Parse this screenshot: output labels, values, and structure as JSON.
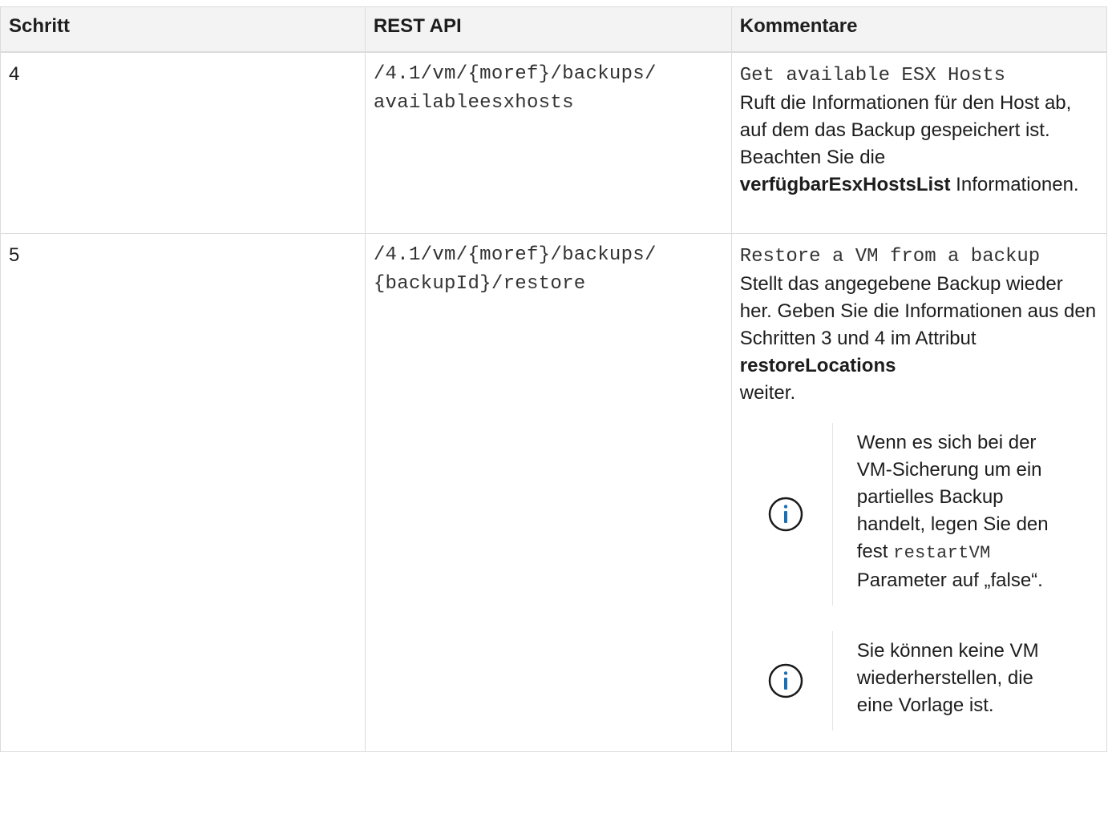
{
  "table": {
    "headers": {
      "step": "Schritt",
      "api": "REST API",
      "comment": "Kommentare"
    },
    "rows": [
      {
        "step": "4",
        "api_line1": "/4.1/vm/{moref}/backups/",
        "api_line2": "availableesxhosts",
        "comment_code": "Get available ESX Hosts",
        "comment_text": "Ruft die Informationen für den Host ab, auf dem das Backup gespeichert ist. Beachten Sie die",
        "comment_bold": "verfügbarEsxHostsList",
        "comment_after": "Informationen."
      },
      {
        "step": "5",
        "api_line1": "/4.1/vm/{moref}/backups/",
        "api_line2": "{backupId}/restore",
        "comment_code": "Restore a VM from a backup",
        "comment_text": "Stellt das angegebene Backup wieder her. Geben Sie die Informationen aus den Schritten 3 und 4 im Attribut",
        "comment_bold": "restoreLocations",
        "comment_after": "weiter.",
        "notes": [
          {
            "text_before": "Wenn es sich bei der VM-Sicherung um ein partielles Backup handelt, legen Sie den fest",
            "code": "restartVM",
            "text_after": "Parameter auf „false“."
          },
          {
            "text": "Sie können keine VM wiederherstellen, die eine Vorlage ist."
          }
        ]
      }
    ]
  },
  "icons": {
    "note_icon": "info-circle-icon",
    "note_icon_color": "#1a6fb5"
  }
}
